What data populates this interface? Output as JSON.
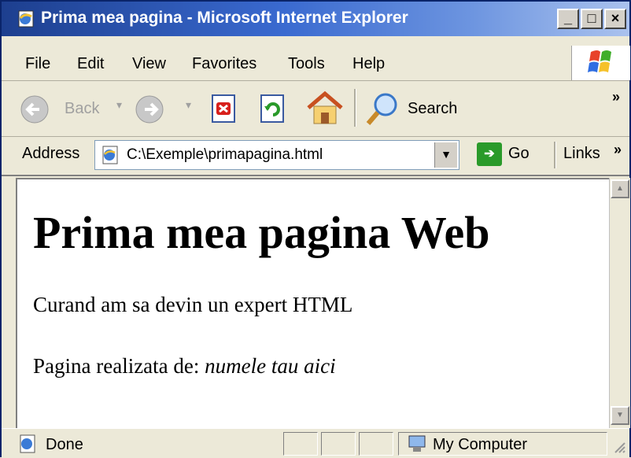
{
  "window": {
    "title": "Prima mea pagina - Microsoft Internet Explorer",
    "controls": {
      "minimize": "_",
      "maximize": "□",
      "close": "×"
    }
  },
  "menu": [
    "File",
    "Edit",
    "View",
    "Favorites",
    "Tools",
    "Help"
  ],
  "toolbar": {
    "back_label": "Back",
    "search_label": "Search",
    "more": "»"
  },
  "address": {
    "label": "Address",
    "value": "C:\\Exemple\\primapagina.html",
    "go_label": "Go",
    "links_label": "Links",
    "links_more": "»"
  },
  "page": {
    "heading": "Prima mea pagina Web",
    "paragraph1": "Curand am sa devin un expert HTML",
    "paragraph2_prefix": "Pagina realizata de: ",
    "paragraph2_italic": "numele tau aici"
  },
  "status": {
    "text": "Done",
    "zone": "My Computer"
  },
  "colors": {
    "titlebar_start": "#1d3f8f",
    "titlebar_end": "#aac2ee",
    "chrome": "#ece9d8"
  }
}
